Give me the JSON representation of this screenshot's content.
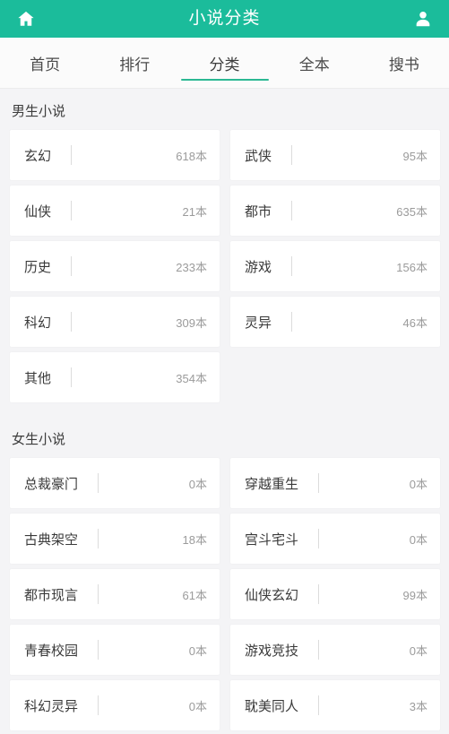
{
  "header": {
    "title": "小说分类",
    "home_icon": "home-icon",
    "user_icon": "user-avatar-icon",
    "background_color": "#1bbc9b"
  },
  "tabs": [
    {
      "label": "首页",
      "active": false
    },
    {
      "label": "排行",
      "active": false
    },
    {
      "label": "分类",
      "active": true
    },
    {
      "label": "全本",
      "active": false
    },
    {
      "label": "搜书",
      "active": false
    }
  ],
  "tab_accent_color": "#2bb893",
  "sections": [
    {
      "title": "男生小说",
      "items": [
        {
          "label": "玄幻",
          "count": "618本"
        },
        {
          "label": "武侠",
          "count": "95本"
        },
        {
          "label": "仙侠",
          "count": "21本"
        },
        {
          "label": "都市",
          "count": "635本"
        },
        {
          "label": "历史",
          "count": "233本"
        },
        {
          "label": "游戏",
          "count": "156本"
        },
        {
          "label": "科幻",
          "count": "309本"
        },
        {
          "label": "灵异",
          "count": "46本"
        },
        {
          "label": "其他",
          "count": "354本"
        }
      ]
    },
    {
      "title": "女生小说",
      "items": [
        {
          "label": "总裁豪门",
          "count": "0本"
        },
        {
          "label": "穿越重生",
          "count": "0本"
        },
        {
          "label": "古典架空",
          "count": "18本"
        },
        {
          "label": "宫斗宅斗",
          "count": "0本"
        },
        {
          "label": "都市现言",
          "count": "61本"
        },
        {
          "label": "仙侠玄幻",
          "count": "99本"
        },
        {
          "label": "青春校园",
          "count": "0本"
        },
        {
          "label": "游戏竞技",
          "count": "0本"
        },
        {
          "label": "科幻灵异",
          "count": "0本"
        },
        {
          "label": "耽美同人",
          "count": "3本"
        }
      ]
    }
  ]
}
